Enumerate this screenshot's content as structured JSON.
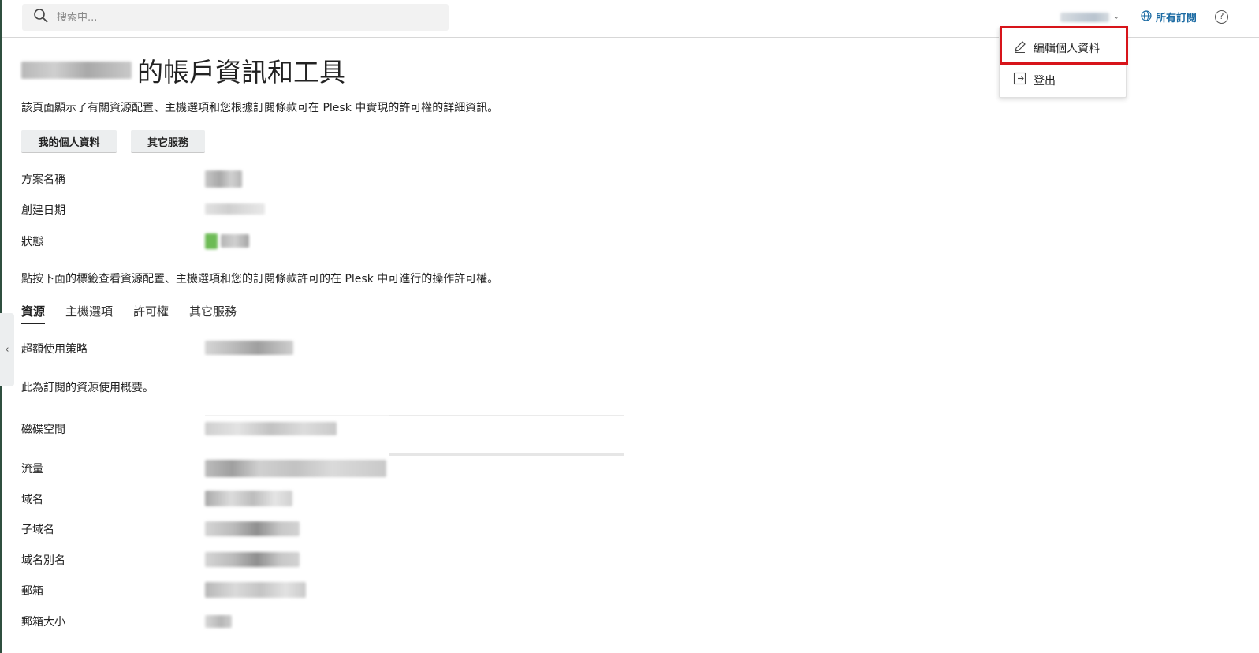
{
  "search": {
    "placeholder": "搜索中..."
  },
  "header": {
    "all_subscriptions": "所有訂閱",
    "help_symbol": "?"
  },
  "user_dropdown": {
    "edit_profile": "編輯個人資料",
    "logout": "登出"
  },
  "page": {
    "title_suffix": "的帳戶資訊和工具",
    "description": "該頁面顯示了有關資源配置、主機選項和您根據訂閱條款可在 Plesk 中實現的許可權的詳細資訊。",
    "buttons": {
      "my_profile": "我的個人資料",
      "other_services": "其它服務"
    },
    "info": {
      "plan_name": "方案名稱",
      "created_date": "創建日期",
      "status": "狀態"
    },
    "hint": "點按下面的標籤查看資源配置、主機選項和您的訂閱條款許可的在 Plesk 中可進行的操作許可權。",
    "tabs": [
      "資源",
      "主機選項",
      "許可權",
      "其它服務"
    ],
    "resources": {
      "overuse_policy": "超額使用策略",
      "summary": "此為訂閱的資源使用概要。",
      "disk_space": "磁碟空間",
      "traffic": "流量",
      "domains": "域名",
      "subdomains": "子域名",
      "domain_aliases": "域名別名",
      "mailboxes": "郵箱",
      "mailbox_size": "郵箱大小"
    }
  },
  "colors": {
    "accent_link": "#1c6ba3",
    "highlight": "#d7141a",
    "status_ok": "#5fb548"
  },
  "icons": [
    "search-icon",
    "chevron-down-icon",
    "globe-icon",
    "help-icon",
    "pencil-icon",
    "logout-icon",
    "chevron-left-icon"
  ]
}
